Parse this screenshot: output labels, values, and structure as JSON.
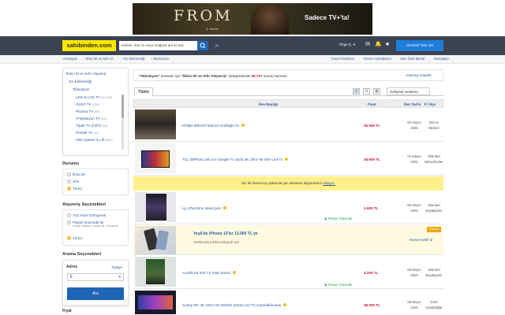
{
  "banner": {
    "title": "FROM",
    "season": "4. Sezon",
    "brand": "Sadece TV+'ta!"
  },
  "header": {
    "logo": "sahibinden.com",
    "search_value": "Kelime, ilan no veya mağaza adı ile ara",
    "user_menu": "Özge Ç. ▾",
    "post_button": "Ücretsiz* İlan Ver"
  },
  "breadcrumb": [
    "Anasayfa",
    "İkinci El ve Sıfır Al...",
    "Ev Elektroniği",
    "Televizyon"
  ],
  "quick_links": [
    "Favori İlanlarım",
    "Favori Aramalarım",
    "Size Özel İlanlar",
    "Karşılaştır"
  ],
  "sidebar": {
    "categories": {
      "root": "İkinci El ve Sıfır Alışveriş",
      "level2": "Ev Elektroniği",
      "level3": "Televizyon",
      "items": [
        {
          "label": "LED & LCD TV",
          "count": "(30.169)"
        },
        {
          "label": "OLED TV",
          "count": "(226)"
        },
        {
          "label": "Plazma TV",
          "count": "(63)"
        },
        {
          "label": "Projeksiyon TV",
          "count": "(63)"
        },
        {
          "label": "Tüplü TV (CRT)",
          "count": "(60)"
        },
        {
          "label": "Portatif TV",
          "count": "(11)"
        },
        {
          "label": "Askı Aparatı & Lift",
          "count": "(552)"
        }
      ]
    },
    "condition": {
      "title": "Durumu",
      "options": [
        "İkinci El",
        "Sıfır",
        "Tümü"
      ]
    },
    "shopping": {
      "title": "Alışveriş Seçenekleri",
      "options": [
        "Yüz Yüze Görüşerek",
        "Param Güvende ile",
        "Tümü"
      ],
      "param_sub": "Kartla Ödeme, Kargo ile Gönderim"
    },
    "search_options": {
      "title": "Arama Seçenekleri",
      "address_label": "Adres",
      "address_link": "Türkiye",
      "select_value": "İl",
      "search_button": "Ara",
      "price_title": "Fiyat"
    }
  },
  "main": {
    "info": {
      "quote": "\"televizyon\"",
      "text1": " araması için ",
      "cat": "\"İkinci El ve Sıfır Alışveriş\"",
      "text2": " kategorisinde ",
      "count": "36.737",
      "text3": " sonuç bulundu."
    },
    "save_search": "Aramayı Kaydet",
    "tab_all": "Tümü",
    "sort": "Gelişmiş sıralama",
    "columns": {
      "title": "İlan Başlığı",
      "price": "Fiyat",
      "date": "İlan Tarihi",
      "location": "İl / İlçe"
    },
    "notice": {
      "pre": "Siz de ilanınızın yukarıda yer almasını istiyorsanız ",
      "link": "tıklayın."
    },
    "listings": [
      {
        "title": "Philips 58PUS7304/12 Ambilight Tv",
        "price": "25.000 TL",
        "date1": "06 Mayıs",
        "date2": "2026",
        "loc1": "Düzce",
        "loc2": "Merkez"
      },
      {
        "title": "TCL 58P635 148 Cm Google Tv Uydu 4K Ultra Hd Sıfır Led Tv",
        "price": "26.900 TL",
        "date1": "01 Mayıs",
        "date2": "2026",
        "loc1": "İstanbul",
        "loc2": "Bahçelievler"
      },
      {
        "title": "Lg 47lw10mo televizyon",
        "price": "3.000 TL",
        "date1": "06 Mayıs",
        "date2": "2026",
        "loc1": "İstanbul",
        "loc2": "Başakşehir",
        "guarantee": "Param Güvende"
      },
      {
        "title": "Arçelik 82-203 TV main board",
        "price": "3.200 TL",
        "date1": "06 Mayıs",
        "date2": "2026",
        "loc1": "İstanbul",
        "loc2": "Başakşehir",
        "guarantee": "Param Güvende"
      },
      {
        "title": "Sunny 65\" 4K Ultra HD webOS Smart Led TV Garantili/Kutulu",
        "price": "35.000 TL",
        "date1": "06 Mayıs",
        "date2": "2026",
        "loc1": "İzmir",
        "loc2": "Karabağlar"
      }
    ],
    "ad": {
      "title": "Yeşil'de iPhone 13'ler 13.000 TL'ye",
      "sub": "Yenilenmiş telefon kolaycık sari",
      "more": "Hemen teklif al",
      "tag": "Reklam"
    }
  }
}
